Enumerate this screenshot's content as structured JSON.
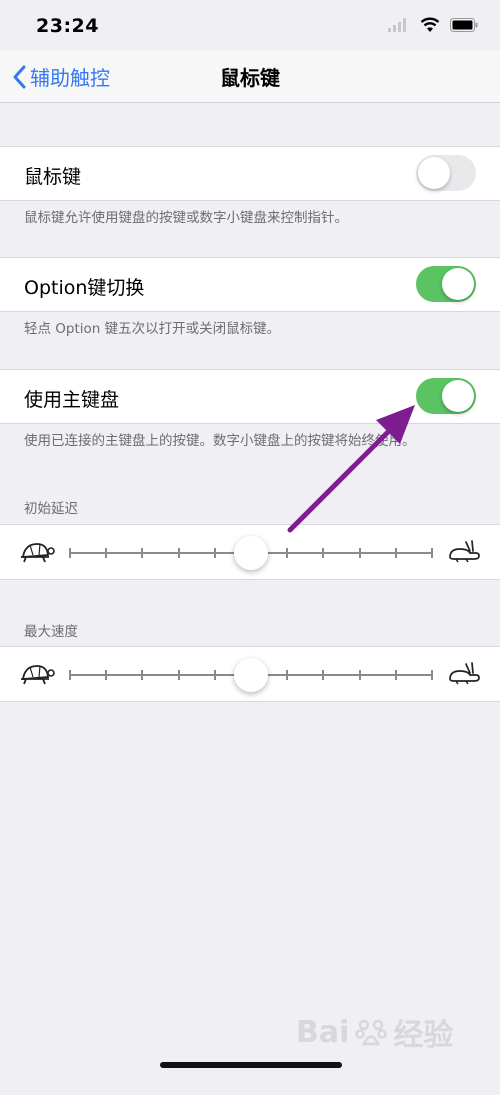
{
  "status_bar": {
    "time": "23:24"
  },
  "nav": {
    "back_label": "辅助触控",
    "title": "鼠标键"
  },
  "settings": [
    {
      "label": "鼠标键",
      "on": false,
      "footer": "鼠标键允许使用键盘的按键或数字小键盘来控制指针。"
    },
    {
      "label": "Option键切换",
      "on": true,
      "footer": "轻点 Option 键五次以打开或关闭鼠标键。"
    },
    {
      "label": "使用主键盘",
      "on": true,
      "footer": "使用已连接的主键盘上的按键。数字小键盘上的按键将始终使用。"
    }
  ],
  "sliders": [
    {
      "header": "初始延迟",
      "value": 0.5,
      "ticks": 10
    },
    {
      "header": "最大速度",
      "value": 0.5,
      "ticks": 10
    }
  ],
  "colors": {
    "switch_on": "#5ac463",
    "accent": "#3478f6",
    "annotation_arrow": "#7d1d8f"
  },
  "watermark": {
    "brand": "Bai",
    "suffix": "经验"
  }
}
